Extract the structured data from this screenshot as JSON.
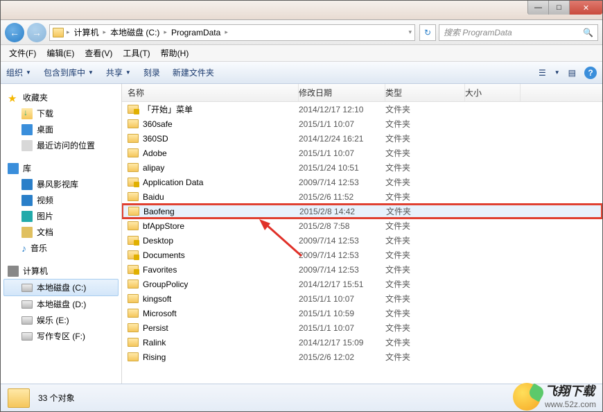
{
  "titlebar": {
    "min": "—",
    "max": "□",
    "close": "✕"
  },
  "nav": {
    "crumbs": [
      "计算机",
      "本地磁盘 (C:)",
      "ProgramData"
    ],
    "refresh": "↻",
    "search_placeholder": "搜索 ProgramData",
    "search_icon": "🔍"
  },
  "menu": {
    "file": "文件(F)",
    "edit": "编辑(E)",
    "view": "查看(V)",
    "tools": "工具(T)",
    "help": "帮助(H)"
  },
  "toolbar": {
    "organize": "组织",
    "include": "包含到库中",
    "share": "共享",
    "burn": "刻录",
    "newfolder": "新建文件夹",
    "view_icon": "☰",
    "preview_icon": "▤",
    "help": "?"
  },
  "sidebar": {
    "favorites": "收藏夹",
    "fav_items": {
      "downloads": "下载",
      "desktop": "桌面",
      "recent": "最近访问的位置"
    },
    "libraries": "库",
    "lib_items": {
      "storm": "暴风影视库",
      "videos": "视频",
      "pictures": "图片",
      "documents": "文档",
      "music": "音乐"
    },
    "computer": "计算机",
    "drives": {
      "c": "本地磁盘 (C:)",
      "d": "本地磁盘 (D:)",
      "e": "娱乐 (E:)",
      "f": "写作专区 (F:)"
    }
  },
  "columns": {
    "name": "名称",
    "date": "修改日期",
    "type": "类型",
    "size": "大小"
  },
  "files": [
    {
      "name": "「开始」菜单",
      "date": "2014/12/17 12:10",
      "type": "文件夹",
      "locked": true
    },
    {
      "name": "360safe",
      "date": "2015/1/1 10:07",
      "type": "文件夹",
      "locked": false
    },
    {
      "name": "360SD",
      "date": "2014/12/24 16:21",
      "type": "文件夹",
      "locked": false
    },
    {
      "name": "Adobe",
      "date": "2015/1/1 10:07",
      "type": "文件夹",
      "locked": false
    },
    {
      "name": "alipay",
      "date": "2015/1/24 10:51",
      "type": "文件夹",
      "locked": false
    },
    {
      "name": "Application Data",
      "date": "2009/7/14 12:53",
      "type": "文件夹",
      "locked": true
    },
    {
      "name": "Baidu",
      "date": "2015/2/6 11:52",
      "type": "文件夹",
      "locked": false
    },
    {
      "name": "Baofeng",
      "date": "2015/2/8 14:42",
      "type": "文件夹",
      "locked": false,
      "highlighted": true,
      "selected": true
    },
    {
      "name": "bfAppStore",
      "date": "2015/2/8 7:58",
      "type": "文件夹",
      "locked": false
    },
    {
      "name": "Desktop",
      "date": "2009/7/14 12:53",
      "type": "文件夹",
      "locked": true
    },
    {
      "name": "Documents",
      "date": "2009/7/14 12:53",
      "type": "文件夹",
      "locked": true
    },
    {
      "name": "Favorites",
      "date": "2009/7/14 12:53",
      "type": "文件夹",
      "locked": true
    },
    {
      "name": "GroupPolicy",
      "date": "2014/12/17 15:51",
      "type": "文件夹",
      "locked": false
    },
    {
      "name": "kingsoft",
      "date": "2015/1/1 10:07",
      "type": "文件夹",
      "locked": false
    },
    {
      "name": "Microsoft",
      "date": "2015/1/1 10:59",
      "type": "文件夹",
      "locked": false
    },
    {
      "name": "Persist",
      "date": "2015/1/1 10:07",
      "type": "文件夹",
      "locked": false
    },
    {
      "name": "Ralink",
      "date": "2014/12/17 15:09",
      "type": "文件夹",
      "locked": false
    },
    {
      "name": "Rising",
      "date": "2015/2/6 12:02",
      "type": "文件夹",
      "locked": false
    }
  ],
  "status": {
    "count": "33 个对象"
  },
  "watermark": {
    "title": "飞翔下载",
    "url": "www.52z.com"
  }
}
